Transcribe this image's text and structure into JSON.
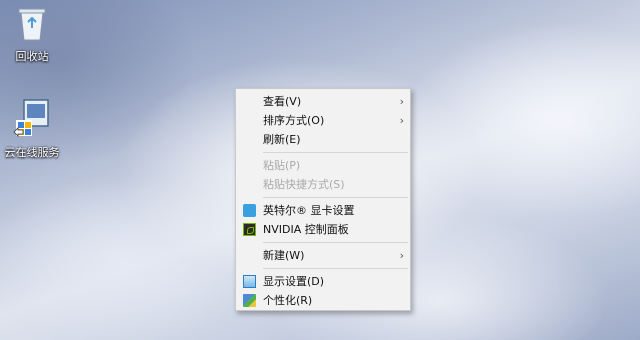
{
  "desktop": {
    "icons": [
      {
        "label": "回收站"
      },
      {
        "label": "云在线服务"
      }
    ]
  },
  "context_menu": {
    "items": [
      {
        "label": "查看(V)"
      },
      {
        "label": "排序方式(O)"
      },
      {
        "label": "刷新(E)"
      },
      {
        "label": "粘贴(P)"
      },
      {
        "label": "粘贴快捷方式(S)"
      },
      {
        "label": "英特尔® 显卡设置"
      },
      {
        "label": "NVIDIA 控制面板"
      },
      {
        "label": "新建(W)"
      },
      {
        "label": "显示设置(D)"
      },
      {
        "label": "个性化(R)"
      }
    ],
    "submenu_arrow": "›"
  }
}
